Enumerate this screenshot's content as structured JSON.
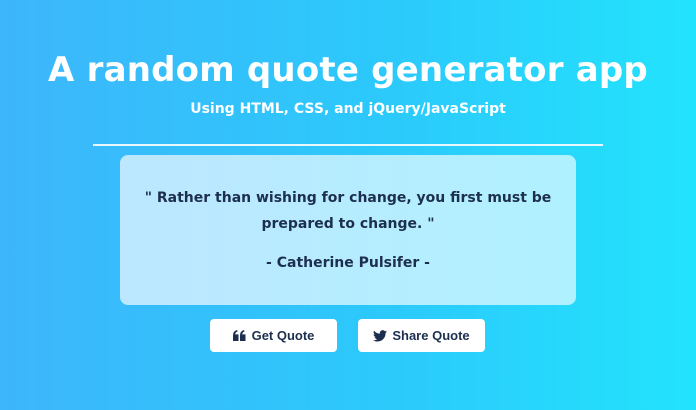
{
  "header": {
    "title": "A random quote generator app",
    "subtitle": "Using HTML, CSS, and jQuery/JavaScript"
  },
  "quote": {
    "text": "\" Rather than wishing for change, you first must be prepared to change. \"",
    "author": "- Catherine Pulsifer -"
  },
  "buttons": {
    "get_quote": {
      "label": "Get Quote",
      "icon": "quote-left-icon"
    },
    "share_quote": {
      "label": "Share Quote",
      "icon": "twitter-icon"
    }
  },
  "colors": {
    "background_start": "#3db6fb",
    "background_end": "#22e3fd",
    "card_start": "#bde7ff",
    "card_end": "#b0f1ff",
    "text_dark": "#1d2f4f",
    "button_bg": "#ffffff"
  }
}
